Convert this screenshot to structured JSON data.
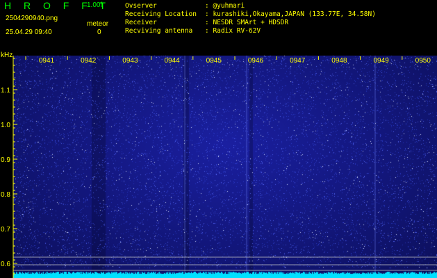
{
  "app": {
    "logo": "H R O F F T",
    "version": "1.00f",
    "filename": "2504290940.png",
    "timestamp": "25.04.29 09:40",
    "meteor_label": "meteor",
    "meteor_count": "0"
  },
  "station": {
    "rows": [
      {
        "key": "Ovserver",
        "value": ": @yuhmari"
      },
      {
        "key": "Receiving Location",
        "value": ": kurashiki,Okayama,JAPAN (133.77E, 34.58N)"
      },
      {
        "key": "Receiver",
        "value": ": NESDR SMArt + HDSDR"
      },
      {
        "key": "Recviving antenna",
        "value": ": Radix RV-62V"
      }
    ]
  },
  "waterfall": {
    "y_unit": "kHz",
    "y_ticks": [
      "1.1",
      "1.0",
      "0.9",
      "0.8",
      "0.7",
      "0.6"
    ],
    "time_ticks": [
      "0941",
      "0942",
      "0943",
      "0944",
      "0945",
      "0946",
      "0947",
      "0948",
      "0949",
      "0950"
    ],
    "colors": {
      "text": "#ffff00",
      "logo": "#00ff00",
      "background": "#12167a",
      "signal": "#00e0ff"
    }
  }
}
